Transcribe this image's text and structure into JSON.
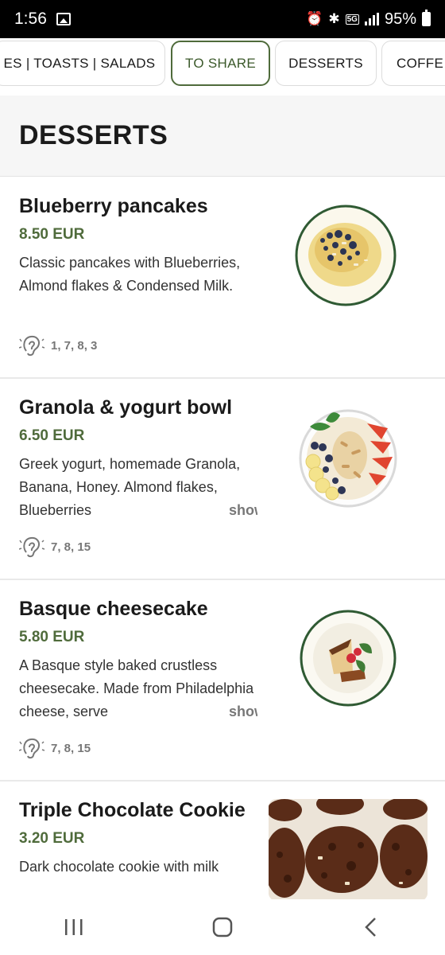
{
  "status_bar": {
    "time": "1:56",
    "network": "5G",
    "battery": "95%"
  },
  "tabs": [
    {
      "label": "ES | TOASTS | SALADS",
      "active": false
    },
    {
      "label": "TO SHARE",
      "active": true
    },
    {
      "label": "DESSERTS",
      "active": false
    },
    {
      "label": "COFFE",
      "active": false
    }
  ],
  "section": {
    "title": "DESSERTS"
  },
  "items": [
    {
      "name": "Blueberry pancakes",
      "price": "8.50 EUR",
      "description": "Classic pancakes with Blueberries, Almond flakes & Condensed Milk.",
      "allergens": "1, 7, 8, 3"
    },
    {
      "name": "Granola & yogurt bowl",
      "price": "6.50 EUR",
      "description": "Greek yogurt, homemade Granola, Banana, Honey. Almond flakes, Blueberries",
      "show_label": "show",
      "allergens": "7, 8, 15"
    },
    {
      "name": "Basque cheesecake",
      "price": "5.80 EUR",
      "description": "A Basque style baked crustless cheesecake. Made from Philadelphia cheese, serve",
      "show_label": "show",
      "allergens": "7, 8, 15"
    },
    {
      "name": "Triple Chocolate Cookie",
      "price": "3.20 EUR",
      "description": "Dark chocolate cookie with milk"
    }
  ],
  "colors": {
    "accent": "#4f6b3b",
    "plate_rim": "#2f5a33"
  }
}
